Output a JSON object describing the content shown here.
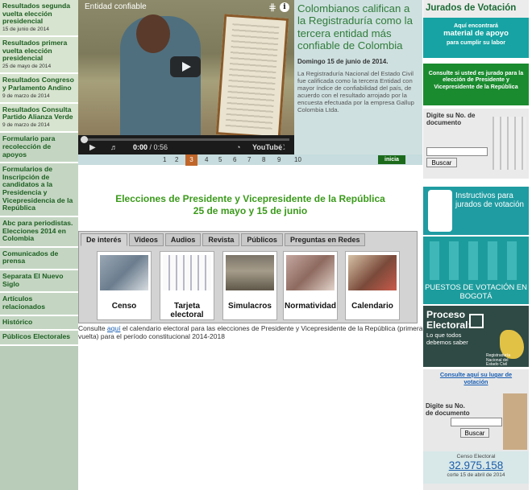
{
  "sidebar": {
    "items": [
      {
        "title": "Resultados segunda vuelta elección presidencial",
        "date": "15 de junio de 2014"
      },
      {
        "title": "Resultados primera vuelta elección presidencial",
        "date": "25 de mayo de 2014"
      },
      {
        "title": "Resultados Congreso y Parlamento Andino",
        "date": "9 de marzo de 2014"
      },
      {
        "title": "Resultados Consulta Partido Alianza Verde",
        "date": "9 de marzo de 2014"
      },
      {
        "title": "Formulario para recolección de apoyos"
      },
      {
        "title": "Formularios de Inscripción de candidatos a la Presidencia y Vicepresidencia de la República"
      },
      {
        "title": "Abc para periodistas. Elecciones 2014 en Colombia"
      },
      {
        "title": "Comunicados de prensa"
      },
      {
        "title": "Separata El Nuevo Siglo"
      },
      {
        "title": "Artículos relacionados"
      },
      {
        "title": "Histórico"
      },
      {
        "title": "Públicos Electorales"
      }
    ]
  },
  "video": {
    "title": "Entidad confiable",
    "time_current": "0:00",
    "time_total": "0:56",
    "youtube": "YouTube",
    "progress": 0
  },
  "headline": {
    "title": "Colombianos califican a la Registraduría como la tercera entidad más confiable de Colombia",
    "date": "Domingo 15 de junio de 2014.",
    "body": "La Registraduría Nacional del Estado Civil fue calificada como la tercera Entidad con mayor índice de confiabilidad del país, de acuerdo con el resultado arrojado por la encuesta efectuada por la empresa Gallup Colombia Ltda."
  },
  "pager": {
    "pages": [
      "1",
      "2",
      "3",
      "4",
      "5",
      "6",
      "7",
      "8",
      "9",
      "10"
    ],
    "current": "3",
    "start_label": "inicia"
  },
  "elections": {
    "line1": "Elecciones de Presidente y Vicepresidente de la República",
    "line2": "25 de mayo y 15 de junio"
  },
  "tabs": {
    "labels": [
      "De interés",
      "Videos",
      "Audios",
      "Revista",
      "Públicos",
      "Preguntas en Redes"
    ],
    "active": "De interés",
    "cards": [
      "Censo",
      "Tarjeta electoral",
      "Simulacros",
      "Normatividad",
      "Calendario"
    ]
  },
  "consulte": {
    "before": "Consulte ",
    "link": "aquí",
    "after": " el calendario electoral para las elecciones de Presidente y Vicepresidente de la República (primera vuelta) para el período constitucional 2014-2018"
  },
  "right": {
    "jurados_title": "Jurados de Votación",
    "jurados_line1": "Aquí encontrará",
    "jurados_line2": "material de apoyo",
    "jurados_line3": "para cumplir su labor",
    "consulta_jurado": "Consulte si usted es jurado para la elección de Presidente y Vicepresidente de la República",
    "doc_label": "Digite su No. de documento",
    "buscar": "Buscar",
    "instructivos": "Instructivos para jurados de votación",
    "puestos": "PUESTOS DE VOTACIÓN EN BOGOTÁ",
    "proceso_title": "Proceso Electoral:",
    "proceso_sub": "Lo que todos debemos saber",
    "proceso_logo": "Registraduría Nacional del Estado Civil",
    "consulte_lugar": "Consulte aquí su lugar de votación",
    "doc_label2": "Digite su No. de documento",
    "buscar2": "Buscar",
    "censo_label": "Censo Electoral",
    "censo_value": "32.975.158",
    "censo_date": "corte 15 de abril de 2014"
  },
  "colors": {
    "brand_green": "#2f7c3a",
    "active_page": "#c0662a",
    "start_button": "#1c6b1c",
    "teal": "#17a3a3"
  }
}
